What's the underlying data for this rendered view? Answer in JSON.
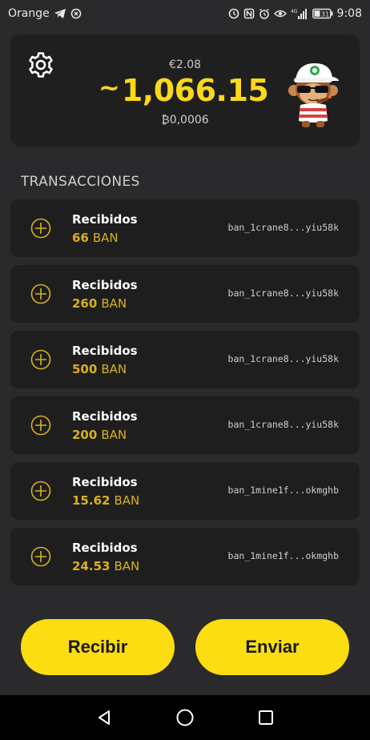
{
  "status_bar": {
    "carrier": "Orange",
    "time": "9:08",
    "battery": "31",
    "network": "4G"
  },
  "balance": {
    "fiat": "€2.08",
    "tilde": "~",
    "ban": "1,066.15",
    "btc": "0,0006",
    "btc_symbol": "₿"
  },
  "section_title": "TRANSACCIONES",
  "transactions": [
    {
      "type": "Recibidos",
      "amount": "66",
      "unit": "BAN",
      "address": "ban_1crane8...yiu58k"
    },
    {
      "type": "Recibidos",
      "amount": "260",
      "unit": "BAN",
      "address": "ban_1crane8...yiu58k"
    },
    {
      "type": "Recibidos",
      "amount": "500",
      "unit": "BAN",
      "address": "ban_1crane8...yiu58k"
    },
    {
      "type": "Recibidos",
      "amount": "200",
      "unit": "BAN",
      "address": "ban_1crane8...yiu58k"
    },
    {
      "type": "Recibidos",
      "amount": "15.62",
      "unit": "BAN",
      "address": "ban_1mine1f...okmghb"
    },
    {
      "type": "Recibidos",
      "amount": "24.53",
      "unit": "BAN",
      "address": "ban_1mine1f...okmghb"
    }
  ],
  "buttons": {
    "receive": "Recibir",
    "send": "Enviar"
  },
  "colors": {
    "accent": "#fbdd11",
    "amount": "#d8b21b",
    "background": "#2a2a2c",
    "card": "#1e1e1f"
  },
  "icons": {
    "settings": "gear-icon",
    "tx": "plus-circle-icon",
    "nav_back": "back-triangle-icon",
    "nav_home": "home-circle-icon",
    "nav_recents": "recents-square-icon"
  }
}
